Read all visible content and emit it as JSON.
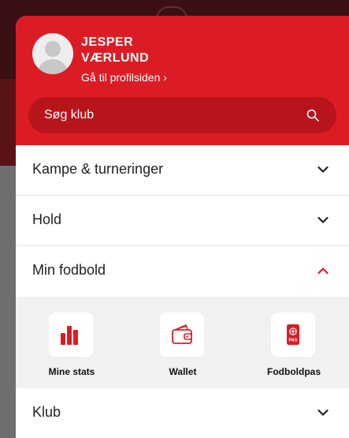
{
  "user": {
    "name_line1": "JESPER",
    "name_line2": "VÆRLUND",
    "profile_link": "Gå til profilsiden ›"
  },
  "search": {
    "placeholder": "Søg klub"
  },
  "menu": {
    "items": [
      {
        "label": "Kampe & turneringer",
        "expanded": false
      },
      {
        "label": "Hold",
        "expanded": false
      },
      {
        "label": "Min fodbold",
        "expanded": true
      },
      {
        "label": "Klub",
        "expanded": false
      }
    ],
    "min_fodbold_tiles": [
      {
        "label": "Mine stats",
        "icon": "bar-chart-icon"
      },
      {
        "label": "Wallet",
        "icon": "wallet-icon"
      },
      {
        "label": "Fodboldpas",
        "icon": "passport-icon"
      },
      {
        "label": "PAS",
        "icon": "passport-text"
      }
    ]
  },
  "colors": {
    "brand_red": "#dc1c24",
    "search_bg": "#b8141b"
  }
}
